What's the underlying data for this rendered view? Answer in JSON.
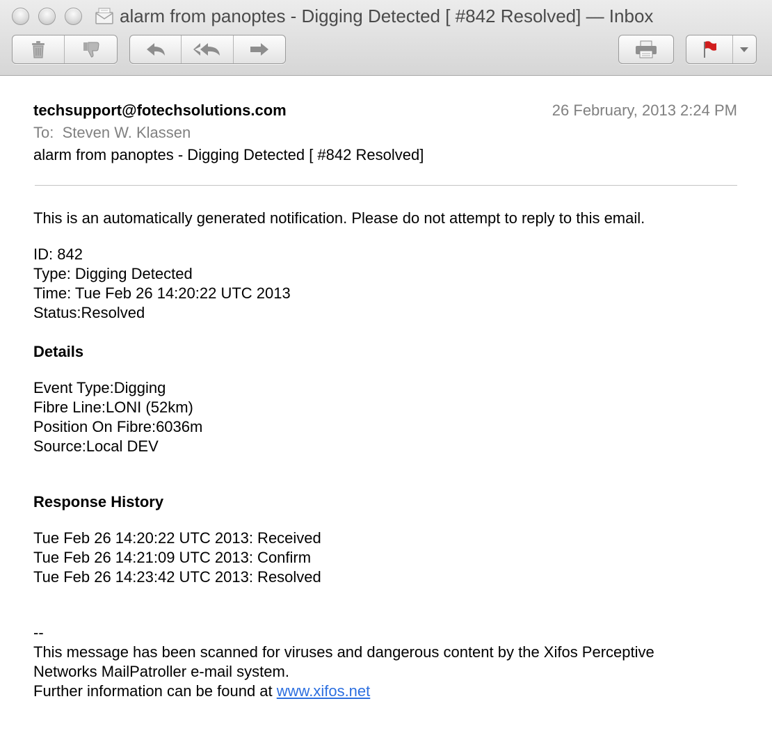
{
  "window": {
    "title": "alarm from panoptes - Digging Detected [ #842 Resolved] — Inbox"
  },
  "toolbar": {
    "buttons": [
      {
        "icon": "trash-icon"
      },
      {
        "icon": "junk-thumbs-down-icon"
      },
      {
        "icon": "reply-icon"
      },
      {
        "icon": "reply-all-icon"
      },
      {
        "icon": "forward-icon"
      },
      {
        "icon": "print-icon"
      },
      {
        "icon": "flag-icon"
      },
      {
        "icon": "chevron-down-icon"
      }
    ],
    "flag_color": "#d11d1d"
  },
  "message": {
    "from": "techsupport@fotechsolutions.com",
    "date": "26 February, 2013 2:24 PM",
    "to_label": "To:",
    "to": "Steven W. Klassen",
    "subject": "alarm from panoptes - Digging Detected [ #842 Resolved]",
    "intro": "This is an automatically generated notification. Please do not attempt to reply to this email.",
    "fields": [
      "ID: 842",
      "Type: Digging Detected",
      "Time: Tue Feb 26 14:20:22 UTC 2013",
      "Status:Resolved"
    ],
    "details_heading": "Details",
    "details": [
      "Event Type:Digging",
      "Fibre Line:LONI (52km)",
      "Position On Fibre:6036m",
      "Source:Local DEV"
    ],
    "history_heading": "Response History",
    "history": [
      "Tue Feb 26 14:20:22 UTC 2013: Received",
      "Tue Feb 26 14:21:09 UTC 2013: Confirm",
      "Tue Feb 26 14:23:42 UTC 2013: Resolved"
    ],
    "signature_sep": "--",
    "footer_1": "This message has been scanned for viruses and dangerous content by the Xifos Perceptive",
    "footer_2": "Networks MailPatroller e-mail system.",
    "footer_3_prefix": "Further information can be found at ",
    "footer_link": "www.xifos.net",
    "link_color": "#2c6fe0"
  }
}
